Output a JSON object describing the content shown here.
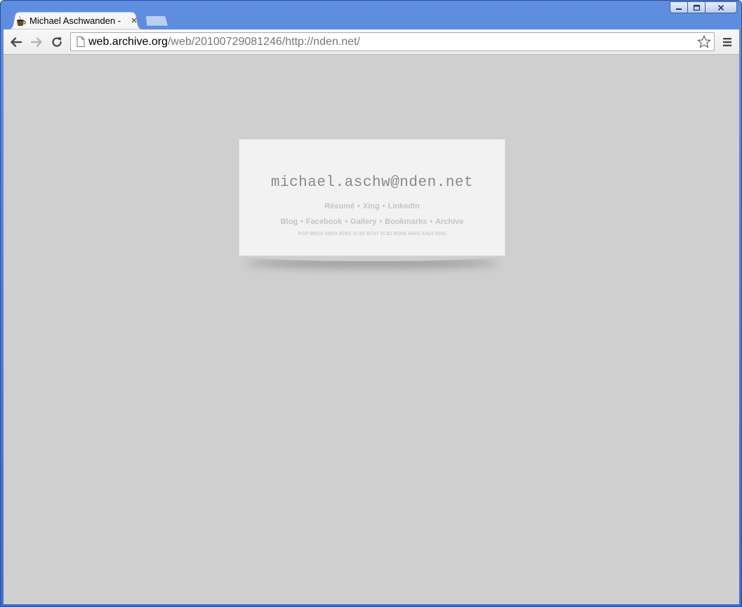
{
  "window": {
    "controls": [
      "minimize",
      "maximize",
      "close"
    ]
  },
  "tab": {
    "title": "Michael Aschwanden -",
    "favicon": "coffee-cup-icon",
    "close_glyph": "×"
  },
  "toolbar": {
    "url_host": "web.archive.org",
    "url_path": "/web/20100729081246/http://nden.net/"
  },
  "card": {
    "email": "michael.aschw@nden.net",
    "links_row1": [
      "Résumé",
      "Xing",
      "LinkedIn"
    ],
    "links_row2": [
      "Blog",
      "Facebook",
      "Gallery",
      "Bookmarks",
      "Archive"
    ],
    "separator": "•",
    "pgp": "PGP  BB1A 58DA 9D83 1C4D 6C67  5C82 BD88 A6F0 A414 4502"
  },
  "colors": {
    "page_background": "#cfcfcf",
    "card_background": "#f2f2f2",
    "email_text": "#8a8a8a",
    "link_text": "#c4c4c4",
    "titlebar": "#4a7bd8"
  }
}
